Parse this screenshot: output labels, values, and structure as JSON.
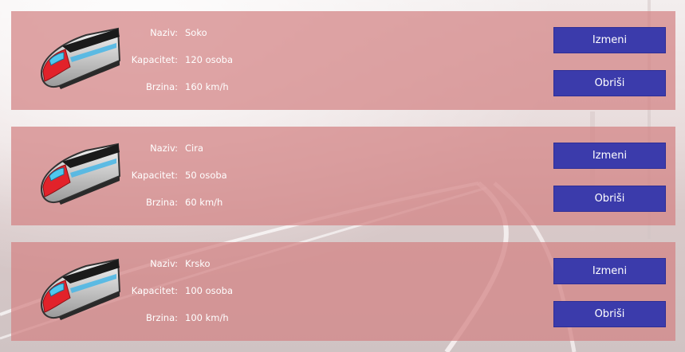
{
  "labels": {
    "name": "Naziv:",
    "capacity": "Kapacitet:",
    "speed": "Brzina:"
  },
  "buttons": {
    "edit": "Izmeni",
    "delete": "Obriši"
  },
  "colors": {
    "card_background": "#d28284",
    "button_background": "#3b3bab",
    "text": "#ffffff"
  },
  "trains": [
    {
      "name": "Soko",
      "capacity": "120 osoba",
      "speed": "160 km/h",
      "icon": "high-speed-train-icon"
    },
    {
      "name": "Cira",
      "capacity": "50 osoba",
      "speed": "60 km/h",
      "icon": "high-speed-train-icon"
    },
    {
      "name": "Krsko",
      "capacity": "100 osoba",
      "speed": "100 km/h",
      "icon": "high-speed-train-icon"
    }
  ]
}
